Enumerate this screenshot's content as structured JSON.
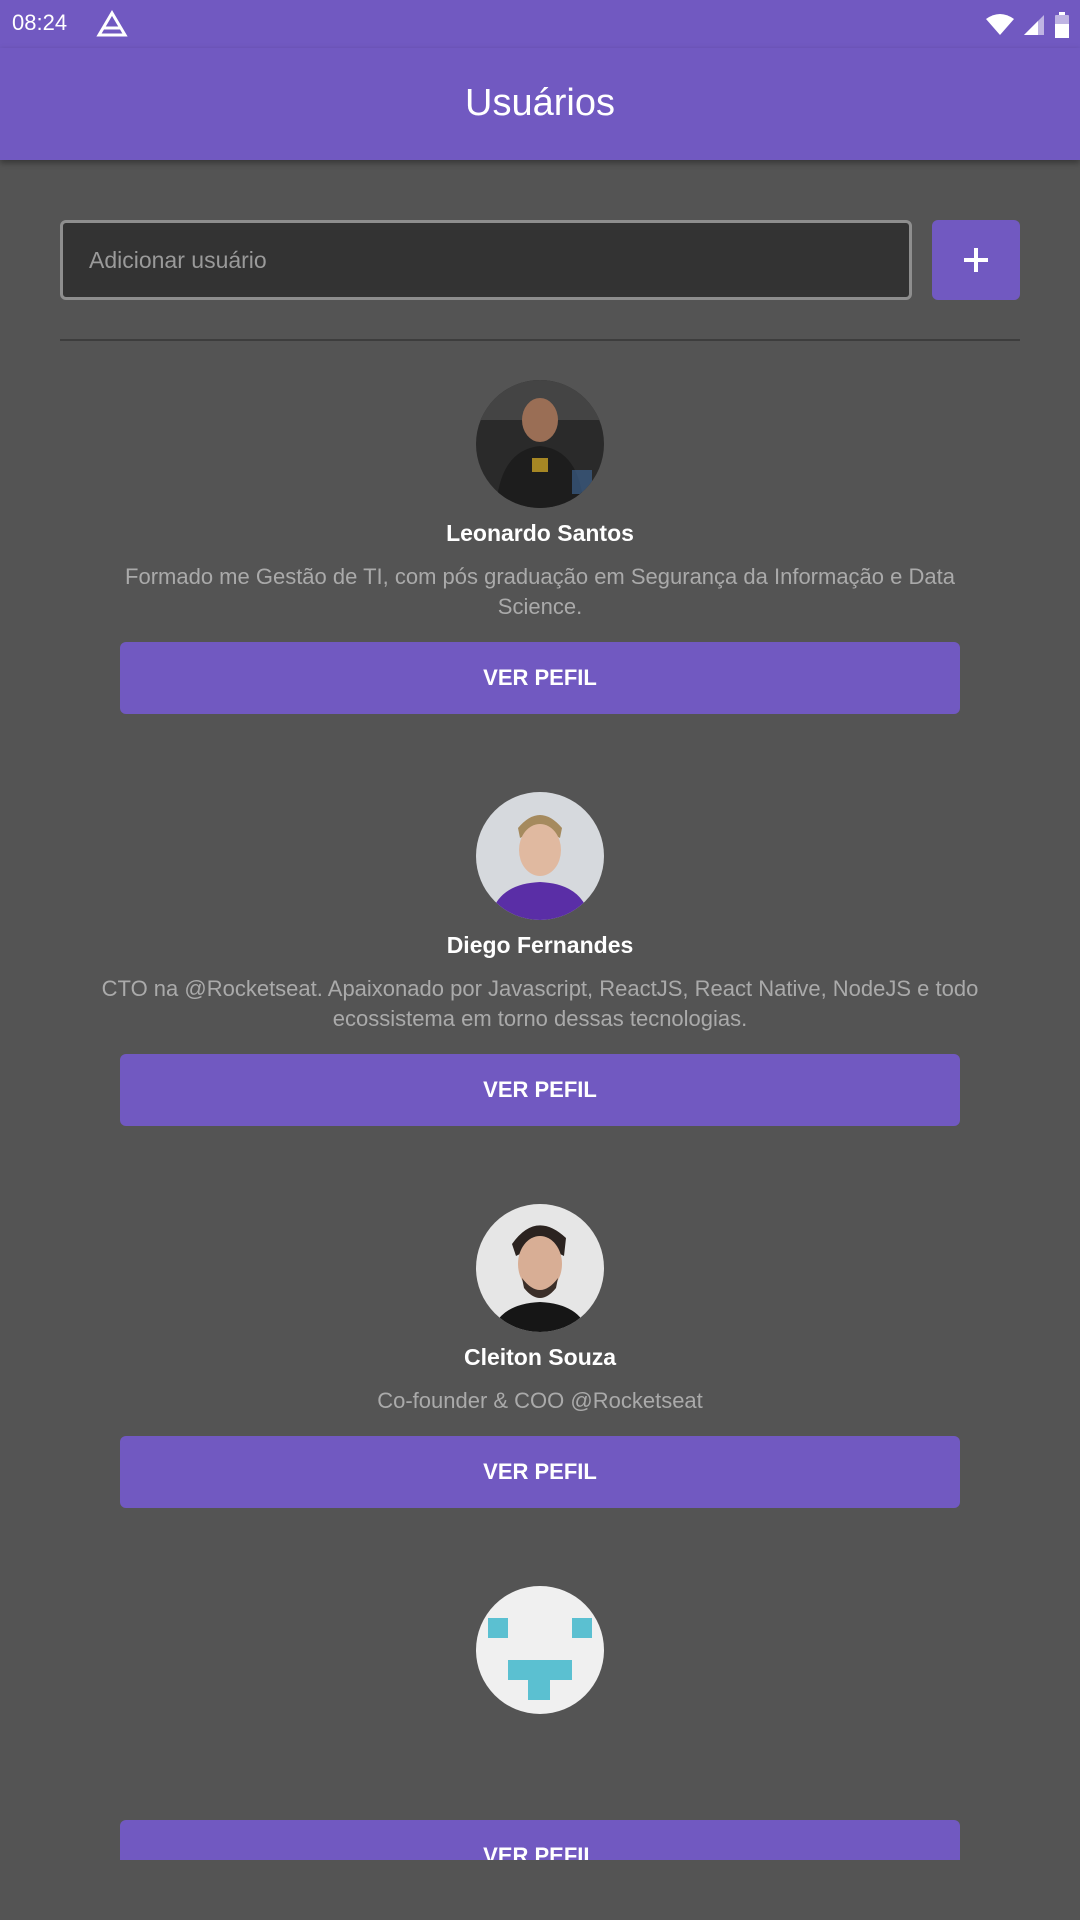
{
  "status_bar": {
    "time": "08:24",
    "icons": [
      "navigation-icon",
      "wifi-icon",
      "signal-icon",
      "battery-icon"
    ]
  },
  "app_bar": {
    "title": "Usuários"
  },
  "add_user": {
    "placeholder": "Adicionar usuário",
    "value": "",
    "button_icon": "plus-icon"
  },
  "users": [
    {
      "name": "Leonardo Santos",
      "bio": "Formado me Gestão de TI, com pós graduação em Segurança da Informação e Data Science.",
      "button": "VER PEFIL"
    },
    {
      "name": "Diego Fernandes",
      "bio": "CTO na @Rocketseat. Apaixonado por Javascript, ReactJS, React Native, NodeJS e todo ecossistema em torno dessas tecnologias.",
      "button": "VER PEFIL"
    },
    {
      "name": "Cleiton Souza",
      "bio": "Co-founder & COO @Rocketseat",
      "button": "VER PEFIL"
    },
    {
      "name": "",
      "bio": "",
      "button": "VER PEFIL"
    }
  ],
  "colors": {
    "primary": "#7159c1",
    "background": "#545454",
    "input_bg": "#333333"
  }
}
